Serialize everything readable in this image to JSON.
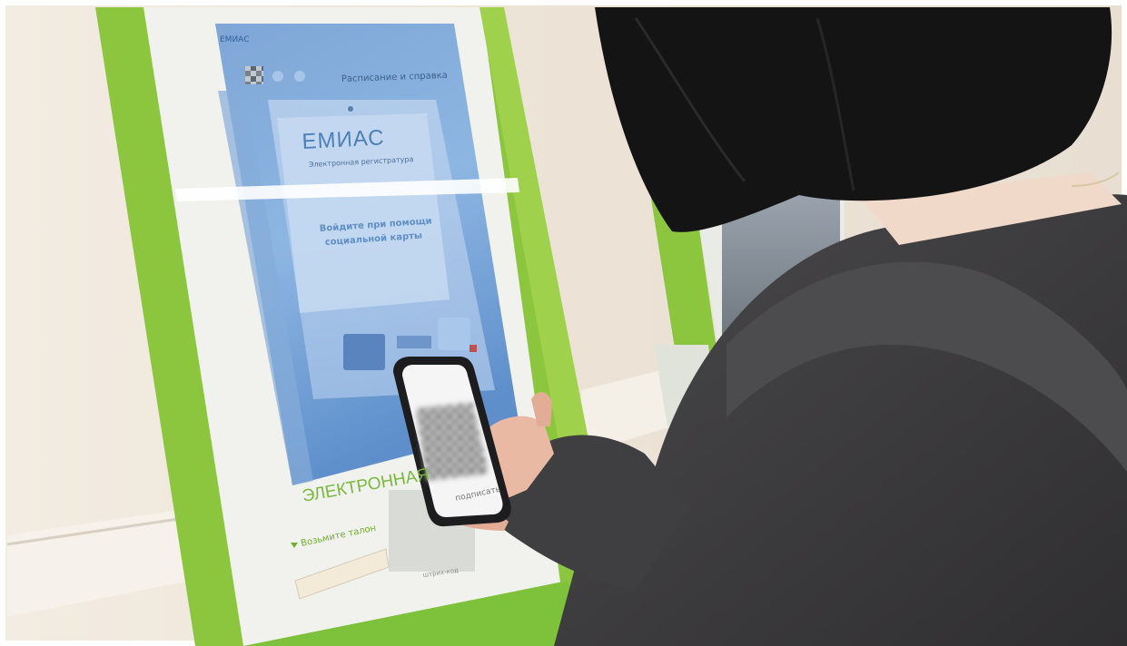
{
  "kiosk": {
    "screen": {
      "corner_brand": "ЕМИАС",
      "menu_label": "Расписание и справка",
      "logo_text": "ЕМИАС",
      "logo_subtitle": "Электронная регистратура",
      "login_prompt_line1": "Войдите при помощи",
      "login_prompt_line2": "социальной карты"
    },
    "panel_text": "ЭЛЕКТРОННАЯ",
    "ticket_label": "Возьмите талон",
    "slot_label": "штрих-код"
  },
  "phone": {
    "caption": "подписать"
  },
  "colors": {
    "kiosk_green": "#8cc63f",
    "kiosk_white": "#f1f2ee",
    "screen_blue": "#6f9fd6",
    "wall": "#efe7dc",
    "hoodie": "#3d3c3e",
    "hair": "#121212"
  }
}
